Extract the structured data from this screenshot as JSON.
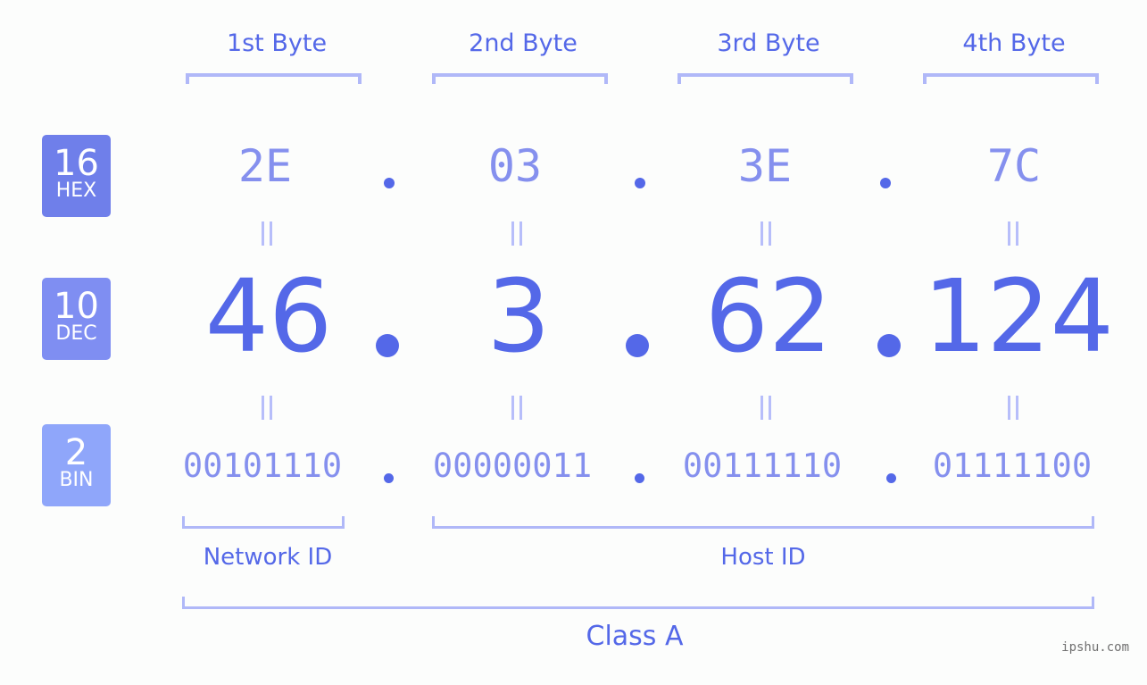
{
  "byte_headers": [
    "1st Byte",
    "2nd Byte",
    "3rd Byte",
    "4th Byte"
  ],
  "badges": {
    "hex": {
      "num": "16",
      "name": "HEX",
      "color": "#6f7fea"
    },
    "dec": {
      "num": "10",
      "name": "DEC",
      "color": "#7f8ef2"
    },
    "bin": {
      "num": "2",
      "name": "BIN",
      "color": "#8fa6fa"
    }
  },
  "ip": {
    "hex": [
      "2E",
      "03",
      "3E",
      "7C"
    ],
    "dec": [
      "46",
      "3",
      "62",
      "124"
    ],
    "bin": [
      "00101110",
      "00000011",
      "00111110",
      "01111100"
    ]
  },
  "segments": {
    "network_id": "Network ID",
    "host_id": "Host ID",
    "class": "Class A"
  },
  "watermark": "ipshu.com",
  "colors": {
    "accent": "#5468e8",
    "light_accent": "#8590ee",
    "bracket": "#b0b8f8"
  }
}
